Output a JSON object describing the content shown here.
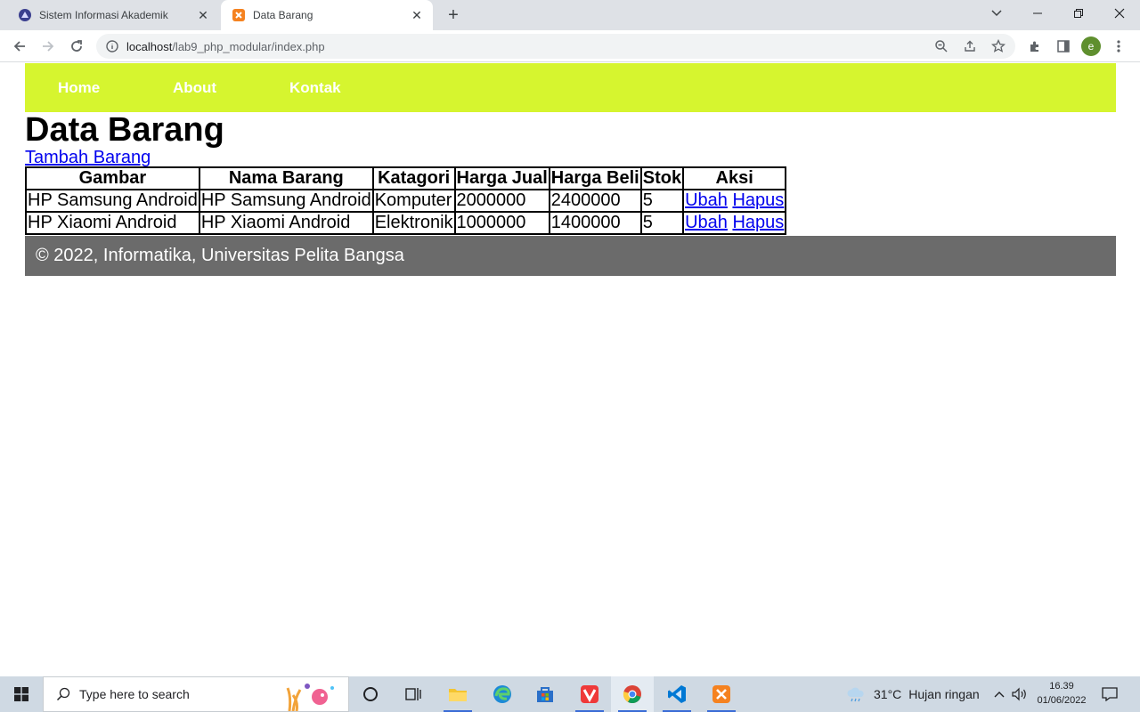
{
  "browser": {
    "tabs": [
      {
        "title": "Sistem Informasi Akademik",
        "active": false,
        "favicon": "university-icon"
      },
      {
        "title": "Data Barang",
        "active": true,
        "favicon": "xampp-icon"
      }
    ],
    "url_host": "localhost",
    "url_path": "/lab9_php_modular/index.php",
    "profile_initial": "e"
  },
  "page": {
    "nav": [
      "Home",
      "About",
      "Kontak"
    ],
    "title": "Data Barang",
    "add_link": "Tambah Barang",
    "table": {
      "headers": [
        "Gambar",
        "Nama Barang",
        "Katagori",
        "Harga Jual",
        "Harga Beli",
        "Stok",
        "Aksi"
      ],
      "rows": [
        {
          "gambar": "HP Samsung Android",
          "nama": "HP Samsung Android",
          "kategori": "Komputer",
          "harga_jual": "2000000",
          "harga_beli": "2400000",
          "stok": "5",
          "ubah": "Ubah",
          "hapus": "Hapus"
        },
        {
          "gambar": "HP Xiaomi Android",
          "nama": "HP Xiaomi Android",
          "kategori": "Elektronik",
          "harga_jual": "1000000",
          "harga_beli": "1400000",
          "stok": "5",
          "ubah": "Ubah",
          "hapus": "Hapus"
        }
      ]
    },
    "footer": "© 2022, Informatika, Universitas Pelita Bangsa",
    "colors": {
      "navbar": "#d6f52f",
      "footer": "#6b6b6b",
      "link": "#0000ee"
    }
  },
  "taskbar": {
    "search_placeholder": "Type here to search",
    "weather_temp": "31°C",
    "weather_text": "Hujan ringan",
    "time": "16.39",
    "date": "01/06/2022"
  }
}
